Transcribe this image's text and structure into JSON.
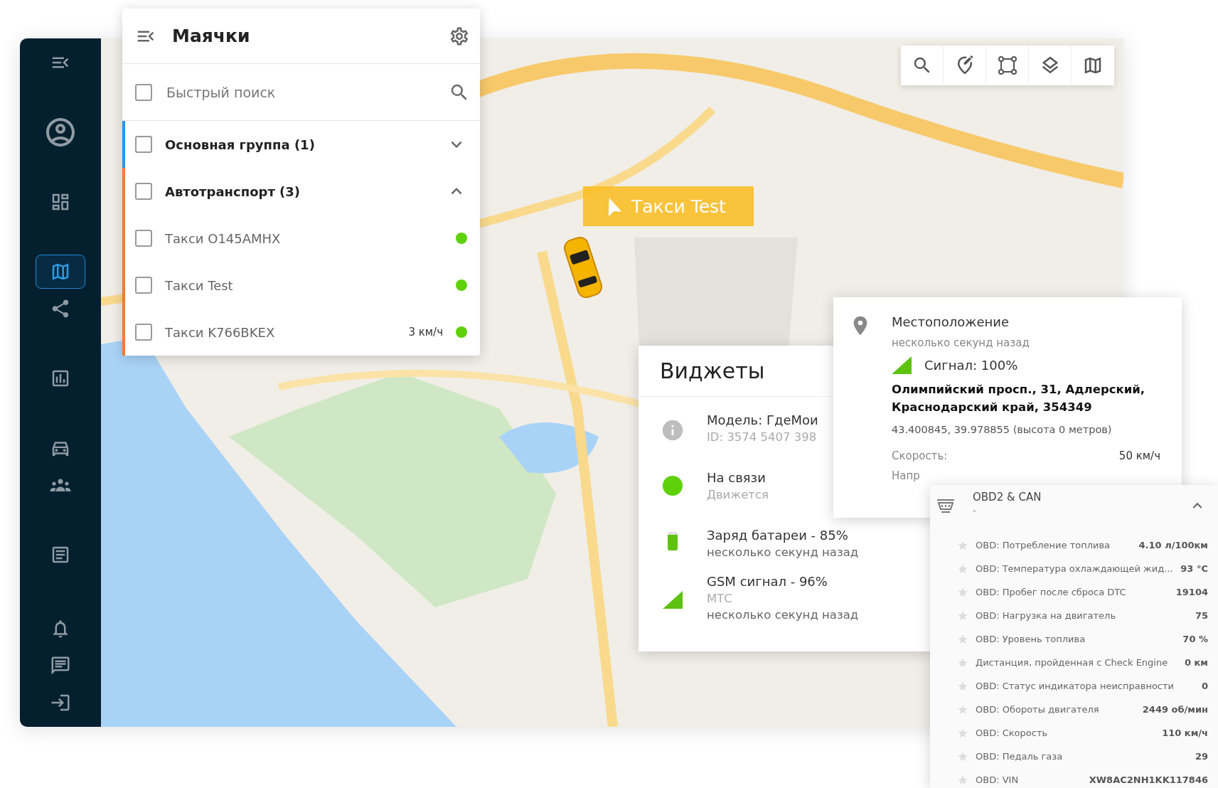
{
  "sidebar": {
    "groups": [
      {
        "items": [
          {
            "kind": "collapse",
            "selected": false
          }
        ]
      },
      {
        "items": [
          {
            "kind": "profile",
            "selected": false
          }
        ]
      },
      {
        "items": [
          {
            "kind": "dashboard",
            "selected": false
          }
        ]
      },
      {
        "items": [
          {
            "kind": "map",
            "selected": true
          },
          {
            "kind": "share",
            "selected": false
          }
        ]
      },
      {
        "items": [
          {
            "kind": "reports",
            "selected": false
          }
        ]
      },
      {
        "items": [
          {
            "kind": "car",
            "selected": false
          },
          {
            "kind": "people",
            "selected": false
          }
        ]
      },
      {
        "items": [
          {
            "kind": "tasks",
            "selected": false
          }
        ]
      },
      {
        "items": [
          {
            "kind": "bell",
            "selected": false
          },
          {
            "kind": "chat",
            "selected": false
          },
          {
            "kind": "logout",
            "selected": false
          }
        ]
      }
    ]
  },
  "beacons_panel": {
    "title": "Маячки",
    "search": {
      "placeholder": "Быстрый поиск",
      "checked": false
    },
    "groups": [
      {
        "label": "Основная группа (1)",
        "color": "#2196f3",
        "checked": false,
        "expanded": false
      },
      {
        "label": "Автотранспорт (3)",
        "color": "#f57c2b",
        "checked": false,
        "expanded": true,
        "children": [
          {
            "label": "Такси O145AMHX",
            "checked": false,
            "online": true
          },
          {
            "label": "Такси Test",
            "checked": false,
            "online": true
          },
          {
            "label": "Такси K766BKEX",
            "speed": "3 км/ч",
            "checked": false,
            "online": true
          }
        ]
      }
    ]
  },
  "map_toolbar": {
    "buttons": [
      {
        "kind": "search"
      },
      {
        "kind": "edit-pin"
      },
      {
        "kind": "polygon"
      },
      {
        "kind": "layers"
      },
      {
        "kind": "map"
      }
    ]
  },
  "vehicle_label": "Такси Test",
  "widgets_panel": {
    "title": "Виджеты",
    "rows": [
      {
        "kind": "info",
        "title": "Модель: ГдеМои",
        "lines": [
          "ID: 3574 5407 398"
        ]
      },
      {
        "kind": "status",
        "title": "На связи",
        "lines": [
          "Движется"
        ],
        "online": true
      },
      {
        "kind": "battery",
        "title": "Заряд батареи - 85%",
        "lines": [
          "несколько секунд назад"
        ],
        "level": 0.85
      },
      {
        "kind": "gsm",
        "title": "GSM сигнал - 96%",
        "lines": [
          "МТС",
          "несколько секунд назад"
        ]
      }
    ]
  },
  "location_popup": {
    "title": "Местоположение",
    "time": "несколько секунд назад",
    "signal": "Сигнал: 100%",
    "address": "Олимпийский просп., 31, Адлерский, Краснодарский край, 354349",
    "coordinates": "43.400845, 39.978855 (высота 0 метров)",
    "rows": [
      {
        "label": "Скорость:",
        "value": "50 км/ч"
      },
      {
        "label": "Напр"
      }
    ]
  },
  "obd_panel": {
    "title": "OBD2 & CAN",
    "subtitle": "-",
    "expanded": true,
    "rows": [
      {
        "label": "OBD: Потребление топлива",
        "value": "4.10 л/100км",
        "starred": false
      },
      {
        "label": "OBD: Температура охлаждающей жид...",
        "value": "93 °C",
        "starred": false
      },
      {
        "label": "OBD: Пробег после сброса DTC",
        "value": "19104",
        "starred": false
      },
      {
        "label": "OBD: Нагрузка на двигатель",
        "value": "75",
        "starred": false
      },
      {
        "label": "OBD: Уровень топлива",
        "value": "70 %",
        "starred": false
      },
      {
        "label": "Дистанция, пройденная с Check Engine",
        "value": "0 км",
        "starred": false
      },
      {
        "label": "OBD: Статус индикатора неисправности",
        "value": "0",
        "starred": false
      },
      {
        "label": "OBD: Обороты двигателя",
        "value": "2449 об/мин",
        "starred": false
      },
      {
        "label": "OBD: Скорость",
        "value": "110 км/ч",
        "starred": false
      },
      {
        "label": "OBD: Педаль газа",
        "value": "29",
        "starred": false
      },
      {
        "label": "OBD: VIN",
        "value": "XW8AC2NH1KK117846",
        "starred": false
      }
    ]
  }
}
